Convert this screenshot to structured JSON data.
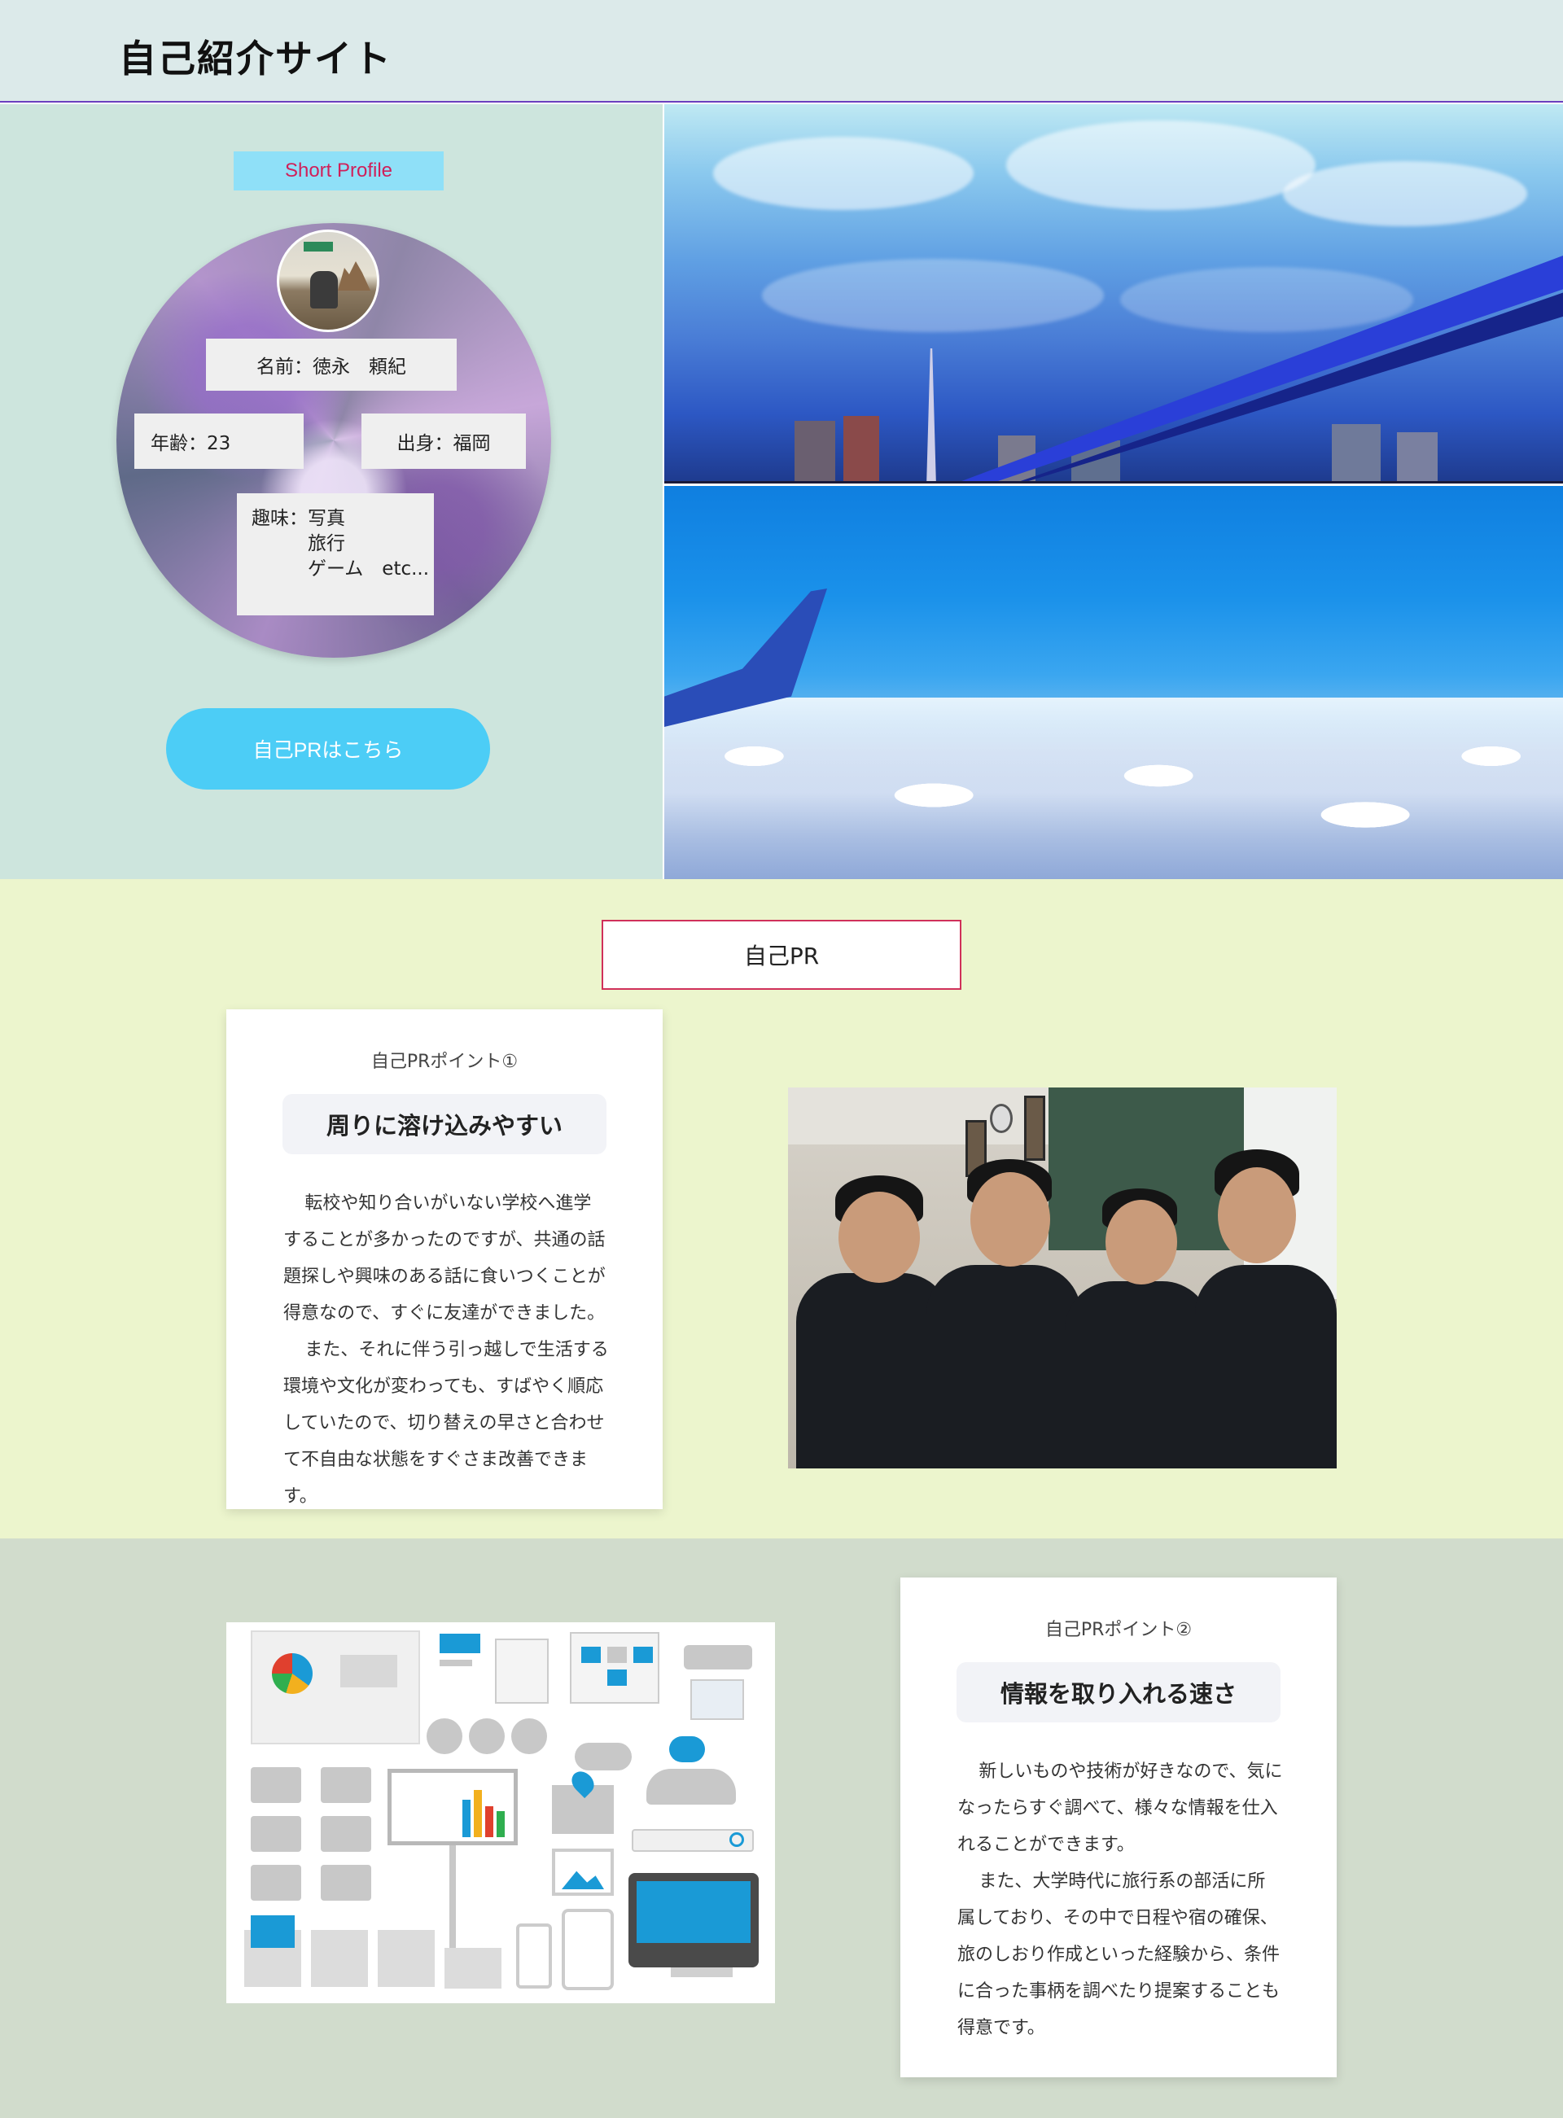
{
  "header": {
    "title": "自己紹介サイト"
  },
  "profile": {
    "label": "Short Profile",
    "name": "名前：徳永　頼紀",
    "age": "年齢：23",
    "hometown": "出身：福岡",
    "hobby_label": "趣味：",
    "hobbies": [
      "写真",
      "旅行",
      "ゲーム　etc..."
    ],
    "button_label": "自己PRはこちら"
  },
  "pr": {
    "heading": "自己PR",
    "point1": {
      "kicker": "自己PRポイント①",
      "title": "周りに溶け込みやすい",
      "paragraphs": [
        "転校や知り合いがいない学校へ進学することが多かったのですが、共通の話題探しや興味のある話に食いつくことが得意なので、すぐに友達ができました。",
        "また、それに伴う引っ越しで生活する環境や文化が変わっても、すばやく順応していたので、切り替えの早さと合わせて不自由な状態をすぐさま改善できます。"
      ]
    },
    "point2": {
      "kicker": "自己PRポイント②",
      "title": "情報を取り入れる速さ",
      "paragraphs": [
        "新しいものや技術が好きなので、気になったらすぐ調べて、様々な情報を仕入れることができます。",
        "また、大学時代に旅行系の部活に所属しており、その中で日程や宿の確保、旅のしおり作成といった経験から、条件に合った事柄を調べたり提案することも得意です。"
      ]
    }
  },
  "colors": {
    "header_bg": "#dceaea",
    "hero_left_bg": "#cde5dd",
    "label_bg": "#8fe0f8",
    "label_text": "#d0205a",
    "button_bg": "#4ccdf6",
    "pr_section_bg": "#ecf5cd",
    "pr_section2_bg": "#d1dccc",
    "heading_border": "#d0305a"
  }
}
